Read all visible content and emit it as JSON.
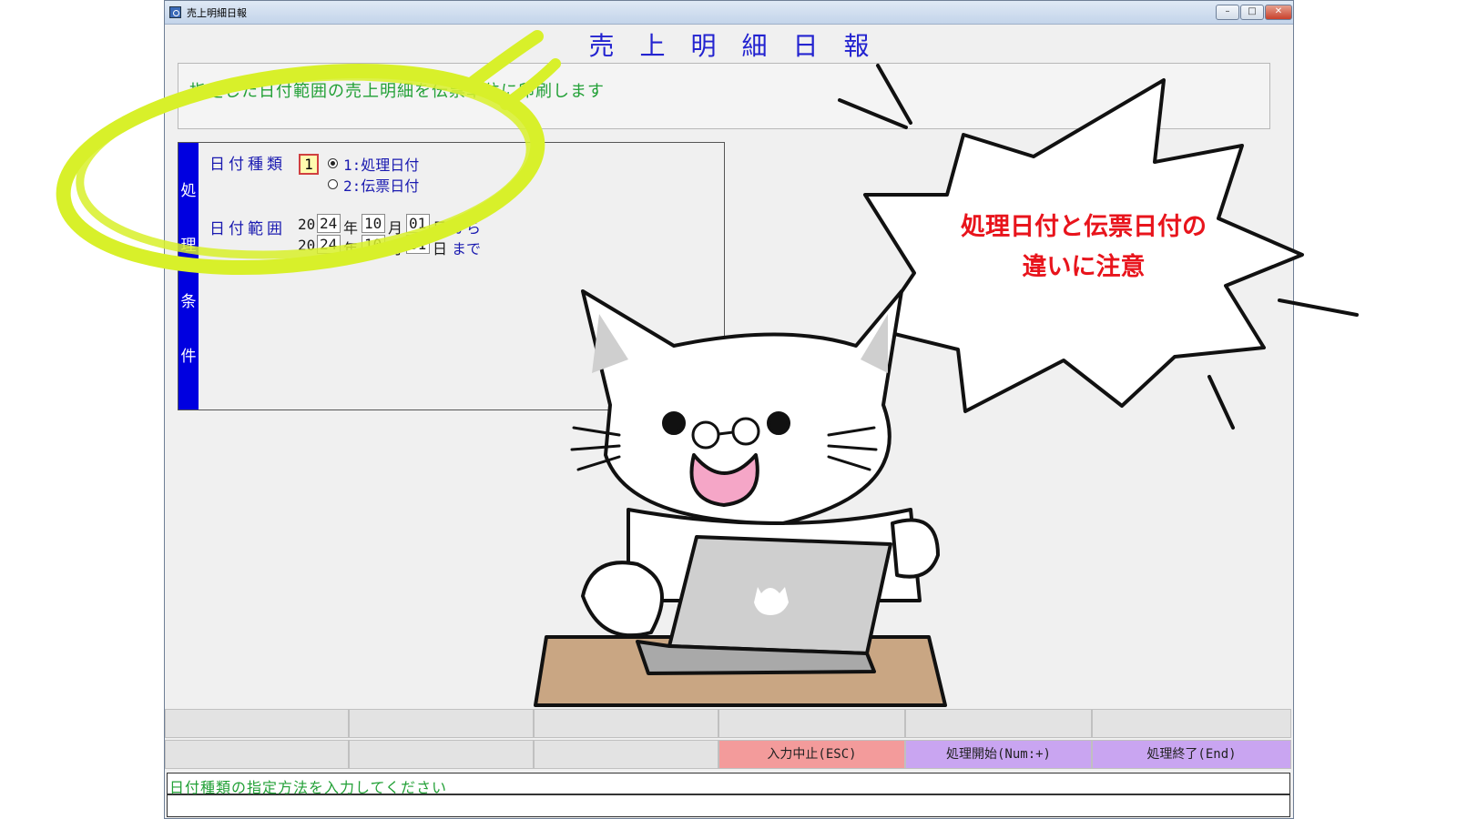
{
  "window": {
    "title": "売上明細日報",
    "controls": {
      "minimize": "–",
      "maximize": "□",
      "close": "✕"
    }
  },
  "form": {
    "title": "売上明細日報",
    "description": "指定した日付範囲の売上明細を伝票単位に印刷します"
  },
  "conditions": {
    "side_label": [
      "処",
      "理",
      "条",
      "件"
    ],
    "date_type": {
      "label": "日付種類",
      "value": "1",
      "options": [
        {
          "label": "1:処理日付",
          "selected": true
        },
        {
          "label": "2:伝票日付",
          "selected": false
        }
      ]
    },
    "date_range": {
      "label": "日付範囲",
      "from": {
        "century": "20",
        "year": "24",
        "year_unit": "年",
        "month": "10",
        "month_unit": "月",
        "day": "01",
        "day_unit": "日",
        "suffix": "から"
      },
      "to": {
        "century": "20",
        "year": "24",
        "year_unit": "年",
        "month": "10",
        "month_unit": "月",
        "day": "31",
        "day_unit": "日",
        "suffix": "まで"
      }
    }
  },
  "function_keys": {
    "row2": [
      "",
      "",
      "",
      "入力中止(ESC)",
      "処理開始(Num:+)",
      "処理終了(End)"
    ]
  },
  "status": {
    "message": "日付種類の指定方法を入力してください"
  },
  "callout": {
    "line1": "処理日付と伝票日付の",
    "line2": "違いに注意"
  },
  "colors": {
    "title_blue": "#2323d0",
    "side_blue": "#0000e0",
    "desc_green": "#22a036",
    "highlight_ring": "#d8f02a",
    "callout_red": "#e8141c",
    "esc_key": "#f39b9b",
    "action_key": "#c9a5f1"
  },
  "illustration": {
    "subject": "white cat with glasses using a laptop at a desk"
  }
}
